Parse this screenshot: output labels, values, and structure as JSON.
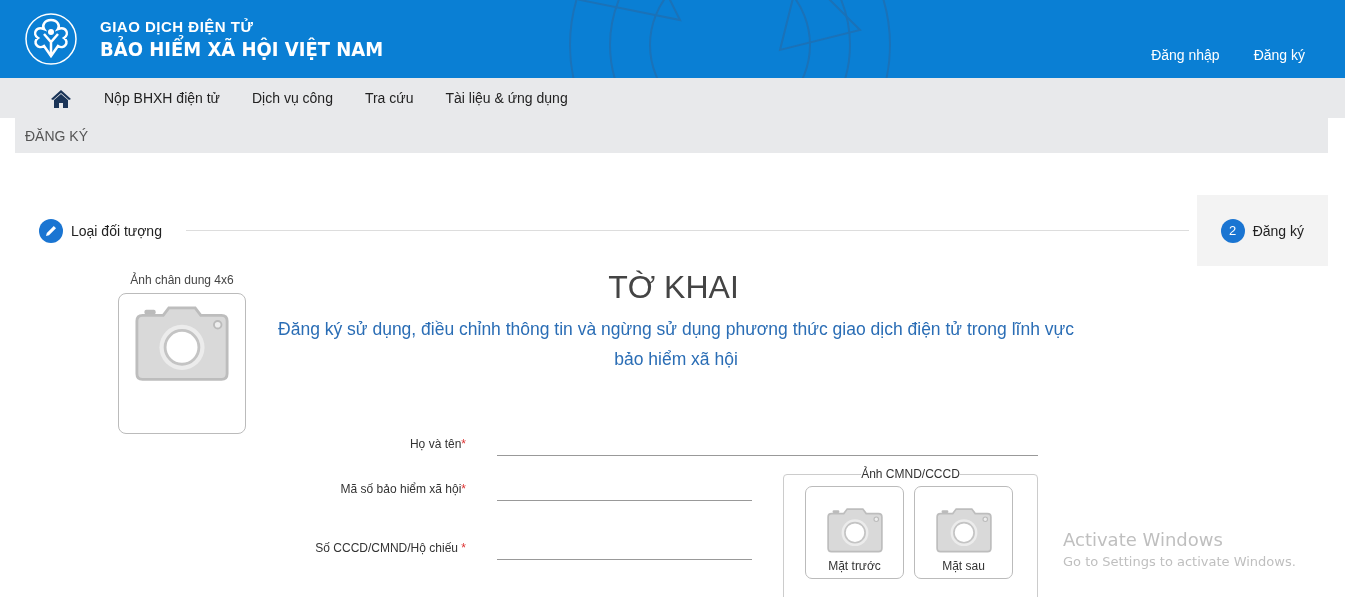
{
  "header": {
    "subtitle": "GIAO DỊCH ĐIỆN TỬ",
    "title": "BẢO HIỂM XÃ HỘI VIỆT NAM",
    "links": [
      "Đăng nhập",
      "Đăng ký"
    ]
  },
  "nav": {
    "items": [
      "Nộp BHXH điện tử",
      "Dịch vụ công",
      "Tra cứu",
      "Tài liệu & ứng dụng"
    ]
  },
  "breadcrumb": "ĐĂNG KÝ",
  "steps": [
    {
      "kind": "edit",
      "label": "Loại đối tượng",
      "selected": false
    },
    {
      "kind": "number",
      "number": "2",
      "label": "Đăng ký",
      "selected": true
    }
  ],
  "portrait": {
    "label": "Ảnh chân dung 4x6"
  },
  "form": {
    "title": "TỜ KHAI",
    "subtitle": "Đăng ký sử dụng, điều chỉnh thông tin và ngừng sử dụng phương thức giao dịch điện tử trong lĩnh vực bảo hiểm xã hội",
    "fields": [
      {
        "kind": "full",
        "label": "Họ và tên",
        "required_mark": "*"
      },
      {
        "kind": "half",
        "label": "Mã số bảo hiểm xã hội",
        "required_mark": "*"
      },
      {
        "kind": "half",
        "label": "Số CCCD/CMND/Hộ chiếu ",
        "required_mark": "*"
      }
    ],
    "id_photos": {
      "legend": "Ảnh CMND/CCCD",
      "sides": [
        "Mặt trước",
        "Mặt sau"
      ]
    }
  },
  "os_notice": {
    "title": "Activate Windows",
    "text": "Go to Settings to activate Windows."
  }
}
